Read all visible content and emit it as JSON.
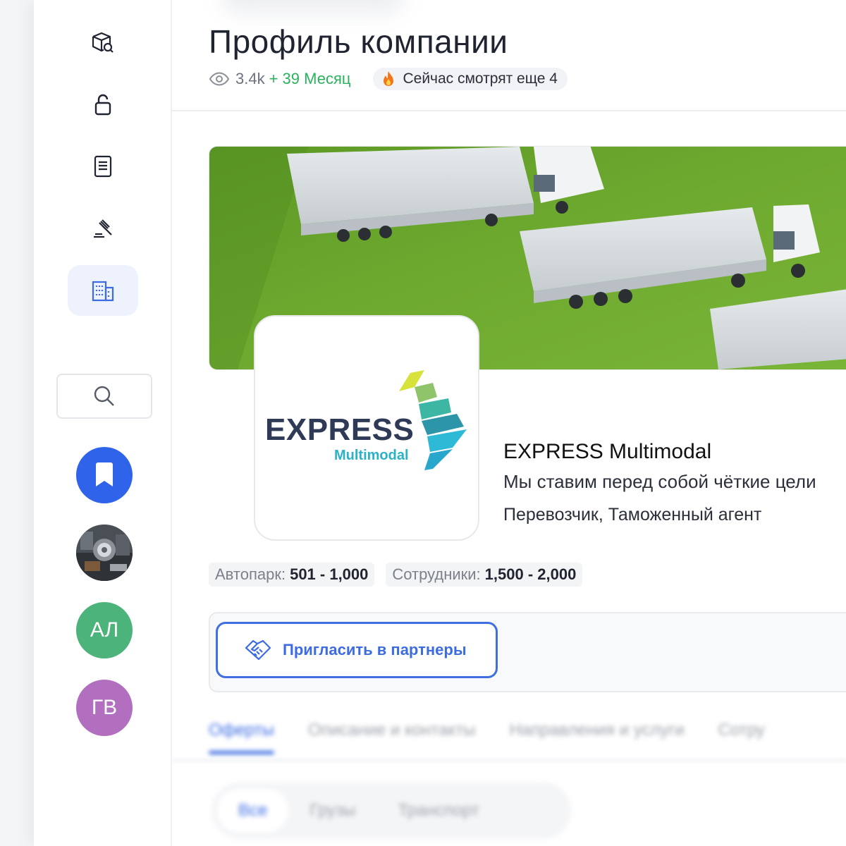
{
  "sidebar": {
    "items": [
      {
        "name": "cargo-search",
        "icon": "box-search-icon"
      },
      {
        "name": "lock",
        "icon": "lock-icon"
      },
      {
        "name": "documents",
        "icon": "notebook-icon"
      },
      {
        "name": "tenders",
        "icon": "gavel-icon"
      },
      {
        "name": "companies",
        "icon": "building-icon",
        "active": true
      }
    ],
    "avatars": [
      {
        "kind": "bookmark",
        "color": "#2f63ea"
      },
      {
        "kind": "photo"
      },
      {
        "initials": "АЛ",
        "color": "#4cb37a"
      },
      {
        "initials": "ГВ",
        "color": "#b26fc0"
      }
    ]
  },
  "header": {
    "title": "Профиль компании",
    "views": "3.4k",
    "growth": "+ 39 Месяц",
    "watching": "Сейчас смотрят еще 4"
  },
  "company": {
    "logo_text": "EXPRESS",
    "logo_subtext": "Multimodal",
    "name": "EXPRESS Multimodal",
    "slogan": "Мы ставим перед собой чёткие цели",
    "roles": "Перевозчик, Таможенный агент",
    "fleet_label": "Автопарк:",
    "fleet_value": "501 - 1,000",
    "employees_label": "Сотрудники:",
    "employees_value": "1,500 - 2,000"
  },
  "actions": {
    "invite_label": "Пригласить в партнеры"
  },
  "tabs": [
    "Оферты",
    "Описание и контакты",
    "Направления и услуги",
    "Сотру"
  ],
  "filters": [
    "Все",
    "Грузы",
    "Транспорт"
  ],
  "colors": {
    "accent": "#3d6be2",
    "growth": "#29b35c",
    "banner_green": "#6ca62e"
  }
}
